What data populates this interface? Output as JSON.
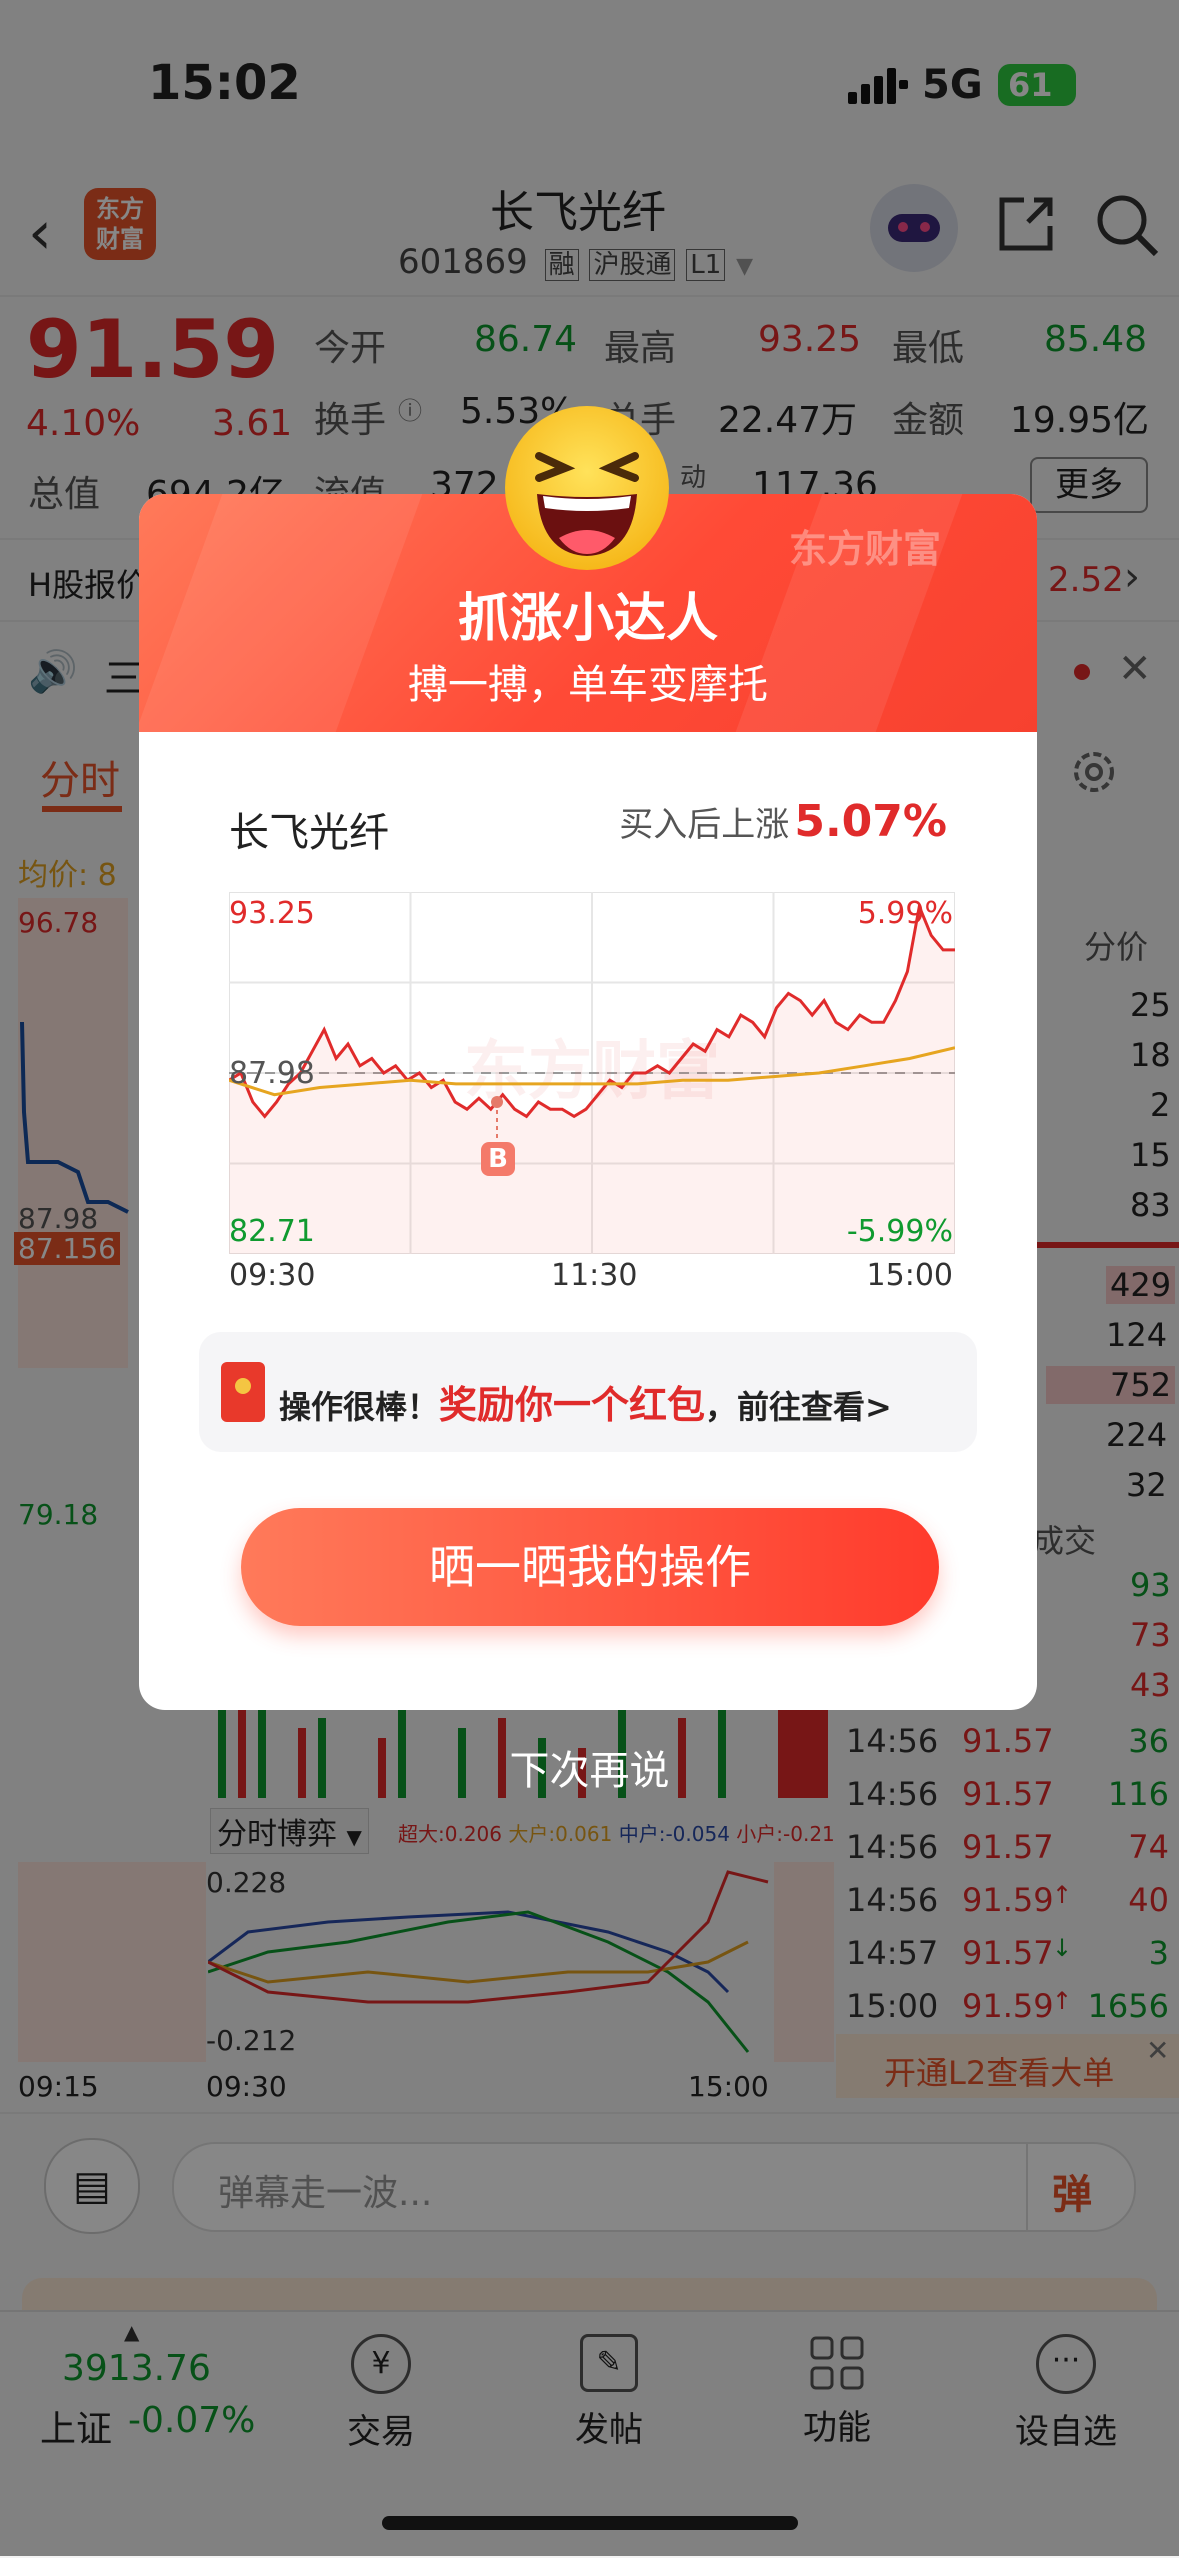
{
  "status_bar": {
    "time": "15:02",
    "network": "5G",
    "battery": "61"
  },
  "header": {
    "back_icon": "chevron-left-icon",
    "logo_text": "东方\n财富",
    "title": "长飞光纤",
    "code": "601869",
    "tags": [
      "融",
      "沪股通",
      "L1"
    ],
    "icons": [
      "robot-avatar-icon",
      "share-icon",
      "search-icon"
    ]
  },
  "quote": {
    "price": "91.59",
    "change_pct": "4.10%",
    "change_abs": "3.61",
    "fields": [
      {
        "label": "今开",
        "value": "86.74",
        "color": "#0f9a2f"
      },
      {
        "label": "最高",
        "value": "93.25",
        "color": "#e02b2b"
      },
      {
        "label": "最低",
        "value": "85.48",
        "color": "#0f9a2f"
      },
      {
        "label": "换手",
        "value": "5.53%",
        "color": "#222"
      },
      {
        "label": "总手",
        "value": "22.47万",
        "color": "#222"
      },
      {
        "label": "金额",
        "value": "19.95亿",
        "color": "#222"
      },
      {
        "label": "总值",
        "value": "694.2亿",
        "color": "#222"
      },
      {
        "label": "流值",
        "value": "372",
        "color": "#222"
      },
      {
        "label": "动",
        "value": "117.36",
        "color": "#222"
      }
    ],
    "more_label": "更多"
  },
  "h_share": {
    "label": "H股报价",
    "value": "2.52"
  },
  "notice": {
    "speaker_icon": "speaker-icon",
    "text": "三",
    "close_icon": "close-icon"
  },
  "tabs": {
    "active": "分时",
    "settings_icon": "gear-icon"
  },
  "main_chart": {
    "avg_label": "均价: 8",
    "y_top": "96.78",
    "y_mid": "87.98",
    "current": "87.156",
    "y_bottom": "79.18",
    "indicator_label": "分时博弈",
    "indicator_legend": [
      {
        "label": "超大:0.206",
        "color": "#e02b2b"
      },
      {
        "label": "大户:0.061",
        "color": "#e0a020"
      },
      {
        "label": "中户:-0.054",
        "color": "#2a4aa8"
      },
      {
        "label": "小户:-0.212",
        "color": "#e02b2b"
      }
    ],
    "ind_top": "0.228",
    "ind_bottom": "-0.212",
    "x_labels": [
      "09:15",
      "09:30",
      "15:00"
    ]
  },
  "order_book": {
    "header": "分价",
    "rows": [
      "25",
      "18",
      "2",
      "15",
      "83"
    ],
    "rows2": [
      "429",
      "124",
      "752",
      "224",
      "32"
    ]
  },
  "trades": {
    "header": "成交",
    "partial": [
      {
        "vol": "93",
        "color": "#0f9a2f"
      },
      {
        "vol": "73",
        "color": "#e02b2b"
      },
      {
        "vol": "43",
        "color": "#e02b2b"
      }
    ],
    "rows": [
      {
        "time": "14:56",
        "price": "91.57",
        "arrow": "",
        "vol": "36",
        "color": "#0f9a2f"
      },
      {
        "time": "14:56",
        "price": "91.57",
        "arrow": "",
        "vol": "116",
        "color": "#0f9a2f"
      },
      {
        "time": "14:56",
        "price": "91.57",
        "arrow": "",
        "vol": "74",
        "color": "#e02b2b"
      },
      {
        "time": "14:56",
        "price": "91.59",
        "arrow": "↑",
        "vol": "40",
        "color": "#e02b2b"
      },
      {
        "time": "14:57",
        "price": "91.57",
        "arrow": "↓",
        "vol": "3",
        "color": "#0f9a2f"
      },
      {
        "time": "15:00",
        "price": "91.59",
        "arrow": "↑",
        "vol": "1656",
        "color": "#0f9a2f"
      }
    ],
    "l2_banner": "开通L2查看大单"
  },
  "comment_bar": {
    "placeholder": "弹幕走一波...",
    "danmu_icon": "弹"
  },
  "bottom_nav": {
    "index_value": "3913.76",
    "index_name": "上证",
    "index_change": "-0.07%",
    "items": [
      {
        "label": "交易",
        "icon": "yen-circle-icon"
      },
      {
        "label": "发帖",
        "icon": "edit-icon"
      },
      {
        "label": "功能",
        "icon": "grid-icon"
      },
      {
        "label": "设自选",
        "icon": "more-dots-icon"
      }
    ]
  },
  "modal": {
    "emoji": "laughing-face-emoji",
    "watermark": "东方财富",
    "title": "抓涨小达人",
    "subtitle": "搏一搏，单车变摩托",
    "stock_name": "长飞光纤",
    "gain_label": "买入后上涨",
    "gain_value": "5.07%",
    "chart_watermark": "东方财富",
    "chart": {
      "y_top": "93.25",
      "y_mid": "87.98",
      "y_bottom": "82.71",
      "pct_top": "5.99%",
      "pct_bottom": "-5.99%",
      "x_labels": [
        "09:30",
        "11:30",
        "15:00"
      ],
      "buy_marker": "B"
    },
    "reward_prefix": "操作很棒！",
    "reward_highlight": "奖励你一个红包",
    "reward_suffix": "，前往查看>",
    "share_button": "晒一晒我的操作",
    "dismiss": "下次再说",
    "colors": {
      "accent": "#f04a3a",
      "title_bg": "#ff5a3c"
    }
  }
}
